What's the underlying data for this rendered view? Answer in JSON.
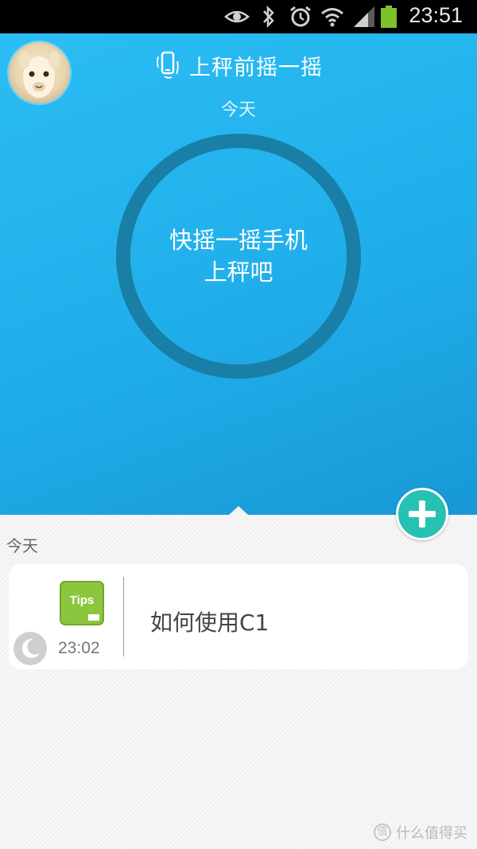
{
  "status_bar": {
    "time": "23:51",
    "icons": [
      "eye-icon",
      "bluetooth-icon",
      "alarm-icon",
      "wifi-icon",
      "signal-icon",
      "battery-icon"
    ]
  },
  "header": {
    "title": "上秤前摇一摇",
    "date": "今天",
    "ring_line1": "快摇一摇手机",
    "ring_line2": "上秤吧"
  },
  "feed": {
    "section_label": "今天",
    "items": [
      {
        "icon_label": "Tips",
        "time": "23:02",
        "title": "如何使用C1"
      }
    ]
  },
  "watermark": {
    "badge": "值",
    "text": "什么值得买"
  },
  "colors": {
    "hero_blue": "#20aeea",
    "ring": "#1a7fa6",
    "add_button": "#27c1b4",
    "tips_green": "#8cc63f"
  }
}
